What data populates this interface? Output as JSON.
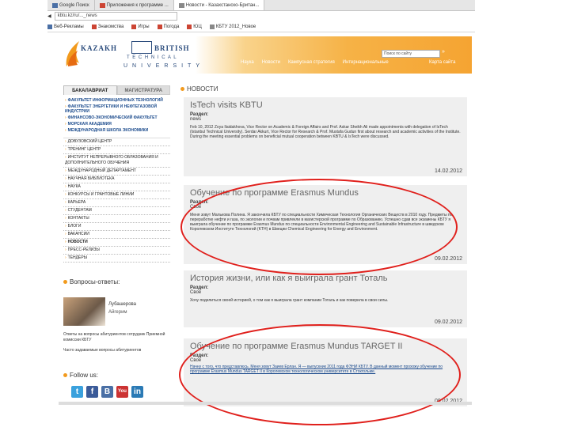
{
  "browser": {
    "tabs": [
      {
        "label": "Google Поиск"
      },
      {
        "label": "Приложения к программе ..."
      },
      {
        "label": "Новости - Казахстанско-Британ..."
      }
    ],
    "address": "kbtu.kz/ru/..._news",
    "bookmarks": [
      "Веб-Рекламы",
      "Знакомства",
      "Игры",
      "Погода",
      "ЮЦ",
      "КБТУ 2012_Новое"
    ]
  },
  "header": {
    "logo_kazakh": "KAZAKH",
    "logo_british": "BRITISH",
    "logo_technical": "T E C H N I C A L",
    "logo_university": "UNIVERSITY",
    "nav": [
      "Наука",
      "Новости",
      "Кампусная стратегия",
      "Интернациональные"
    ],
    "search_placeholder": "Поиск по сайту",
    "go": "»",
    "sitemap": "Карта сайта"
  },
  "sidebar": {
    "tab_bachelor": "БАКАЛАВРИАТ",
    "tab_master": "МАГИСТРАТУРА",
    "faculties": [
      "ФАКУЛЬТЕТ ИНФОРМАЦИОННЫХ ТЕХНОЛОГИЙ",
      "ФАКУЛЬТЕТ ЭНЕРГЕТИКИ И НЕФТЕГАЗОВОЙ ИНДУСТРИИ",
      "ФИНАНСОВО-ЭКОНОМИЧЕСКИЙ ФАКУЛЬТЕТ",
      "МОРСКАЯ АКАДЕМИЯ",
      "МЕЖДУНАРОДНАЯ ШКОЛА ЭКОНОМИКИ"
    ],
    "links": [
      "ДОВУЗОВСКИЙ ЦЕНТР",
      "ТРЕНИНГ ЦЕНТР",
      "ИНСТИТУТ НЕПРЕРЫВНОГО ОБРАЗОВАНИЯ И ДОПОЛНИТЕЛЬНОГО ОБУЧЕНИЯ",
      "МЕЖДУНАРОДНЫЙ ДЕПАРТАМЕНТ",
      "НАУЧНАЯ БИБЛИОТЕКА",
      "НАУКА",
      "КОНКУРСЫ И ГРАНТОВЫЕ ЛИНИИ",
      "КАРЬЕРА",
      "СТУДЕНТАМ",
      "КОНТАКТЫ",
      "БЛОГИ",
      "ВАКАНСИИ",
      "НОВОСТИ",
      "ПРЕСС-РЕЛИЗЫ",
      "ТЕНДЕРЫ"
    ],
    "current_link": "НОВОСТИ",
    "qa_title": "Вопросы-ответы:",
    "qa_name": "Лубашерова",
    "qa_role": "Айгерим",
    "qa_text1": "Ответы на вопросы абитуриентов сотрудник Приемной комиссии КБТУ",
    "qa_text2": "Часто задаваемые вопросы абитуриентов",
    "follow_title": "Follow us:",
    "social": [
      "t",
      "f",
      "B",
      "You",
      "in"
    ]
  },
  "news": {
    "header": "НОВОСТИ",
    "items": [
      {
        "title": "IsTech visits KBTU",
        "section_label": "Раздел:",
        "section_value": "news",
        "body": "Feb 10, 2012 Zoya Ilaidakhova, Vice Rector on Academic & Foreign Affairs and Prof. Askar Sheikh Ali made appointments with delegation of IsTech (Istanbul Technical University). Serdar Akkurt, Vice Rector for Research & Prof. Mustafa Gudun first about research and academic activities of the Institute. During the meeting essential problems on beneficial mutual cooperation between KBTU & IsTech were discussed.",
        "date": "14.02.2012"
      },
      {
        "title": "Обучение по программе Erasmus Mundus",
        "section_label": "Раздел:",
        "section_value": "Своё",
        "body": "Меня зовут Малькова Полина. Я закончила КБТУ по специальности Химическая Технология Органических Веществ в 2010 году. Предметы по переработке нефти и газа, по экологии и почвам привлекли в магистерской программе по Образованию. Успешно сдав все экзамены КБТУ я выиграла обучение по программе Erasmus Mundus по специальности Environmental Engineering and Sustainable Infrastructure в шведском Королевском Институте Технологий (KTH) в Швеции Chemical Engineering for Energy and Environment.",
        "date": "09.02.2012"
      },
      {
        "title": "История жизни, или как я выиграла грант Тоталь",
        "section_label": "Раздел:",
        "section_value": "Своё",
        "body": "Хочу поделиться своей историей, о том как я выиграла грант компании Тоталь и как поверила в свои силы.",
        "date": "09.02.2012"
      },
      {
        "title": "Обучение по программе Erasmus Mundus TARGET II",
        "section_label": "Раздел:",
        "section_value": "Своё",
        "body": "Начну с того, что представлюсь. Меня зовут Заиев Ерлан. Я — выпускник 2011 года ФЭНИ КБТУ. В данный момент прохожу обучение по программе Erasmus Mundus TARGET II в Королевском технологическом университете в Стокгольме.",
        "date": "09.02.2012"
      }
    ]
  },
  "colors": {
    "accent_orange": "#f29a1d",
    "link_blue": "#1a4a8c",
    "annotation_red": "#e0201c"
  }
}
